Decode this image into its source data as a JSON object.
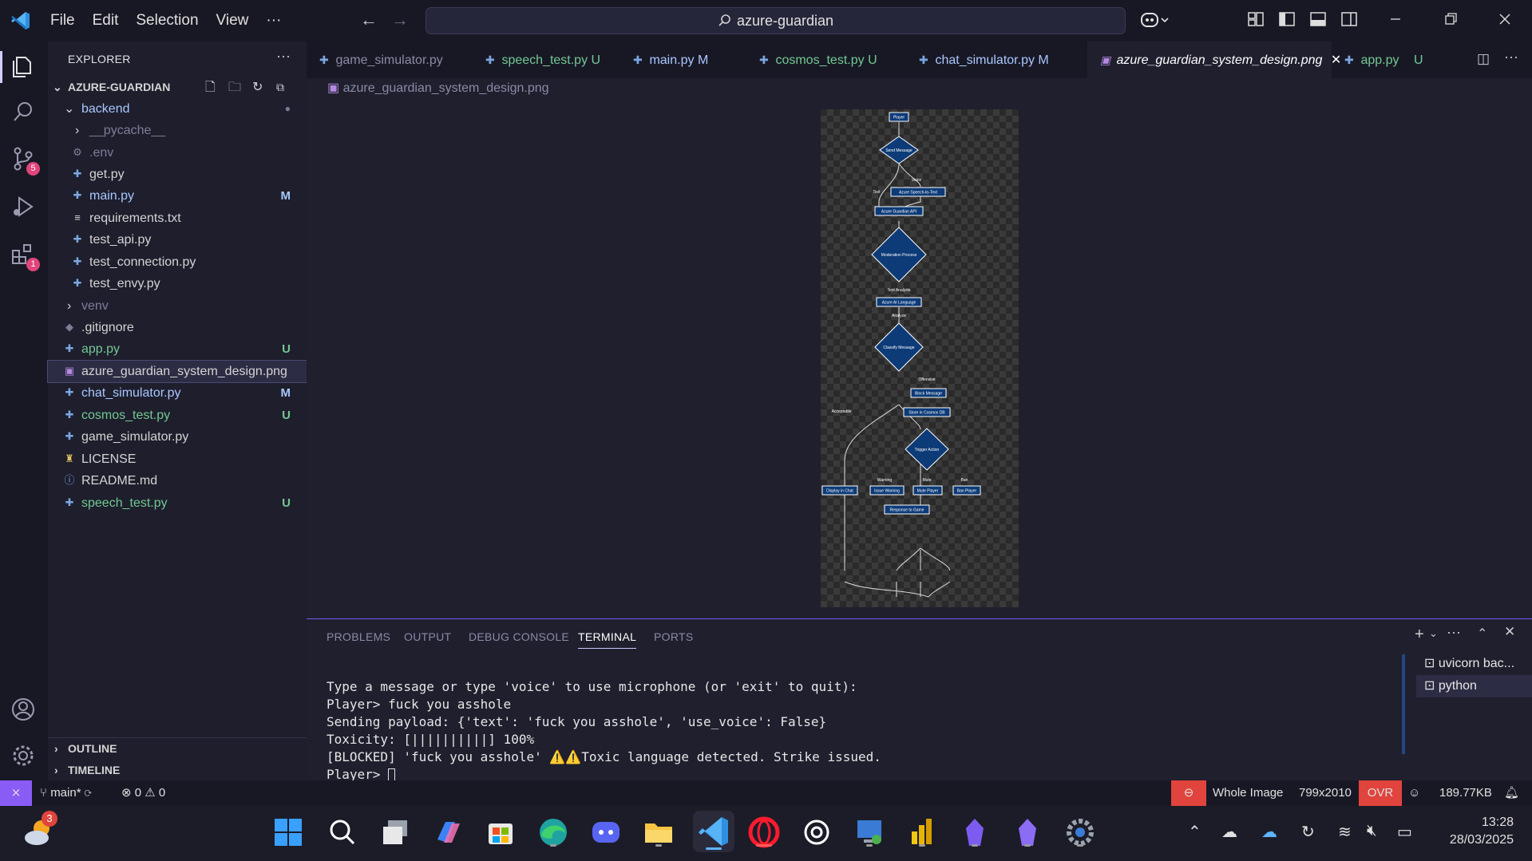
{
  "titlebar": {
    "menus": [
      "File",
      "Edit",
      "Selection",
      "View",
      "···"
    ],
    "search_text": "azure-guardian"
  },
  "activitybar": {
    "scm_badge": "5",
    "extensions_badge": "1"
  },
  "sidebar": {
    "title": "EXPLORER",
    "more": "···",
    "folder_title": "AZURE-GUARDIAN",
    "items": [
      {
        "label": "backend",
        "status": "●"
      },
      {
        "label": "__pycache__",
        "status": ""
      },
      {
        "label": ".env",
        "status": ""
      },
      {
        "label": "get.py",
        "status": ""
      },
      {
        "label": "main.py",
        "status": "M"
      },
      {
        "label": "requirements.txt",
        "status": ""
      },
      {
        "label": "test_api.py",
        "status": ""
      },
      {
        "label": "test_connection.py",
        "status": ""
      },
      {
        "label": "test_envy.py",
        "status": ""
      },
      {
        "label": "venv",
        "status": ""
      },
      {
        "label": ".gitignore",
        "status": ""
      },
      {
        "label": "app.py",
        "status": "U"
      },
      {
        "label": "azure_guardian_system_design.png",
        "status": ""
      },
      {
        "label": "chat_simulator.py",
        "status": "M"
      },
      {
        "label": "cosmos_test.py",
        "status": "U"
      },
      {
        "label": "game_simulator.py",
        "status": ""
      },
      {
        "label": "LICENSE",
        "status": ""
      },
      {
        "label": "README.md",
        "status": ""
      },
      {
        "label": "speech_test.py",
        "status": "U"
      }
    ],
    "outline": "OUTLINE",
    "timeline": "TIMELINE"
  },
  "tabs": [
    {
      "label": "game_simulator.py",
      "status": ""
    },
    {
      "label": "speech_test.py",
      "status": "U"
    },
    {
      "label": "main.py",
      "status": "M"
    },
    {
      "label": "cosmos_test.py",
      "status": "U"
    },
    {
      "label": "chat_simulator.py",
      "status": "M"
    },
    {
      "label": "azure_guardian_system_design.png",
      "status": "✕"
    },
    {
      "label": "app.py",
      "status": "U"
    }
  ],
  "breadcrumb": "azure_guardian_system_design.png",
  "diagram": {
    "player": "Player",
    "send_message": "Send Message",
    "voice": "Voice",
    "text": "Text",
    "speech_to_text": "Azure Speech-to-Text",
    "guardian_api": "Azure Guardian API",
    "moderation": "Moderation Process",
    "text_analysis": "Text Analysis",
    "ai_language": "Azure AI Language",
    "analyze": "Analyze",
    "classify": "Classify Message",
    "offensive": "Offensive",
    "acceptable": "Acceptable",
    "block": "Block Message",
    "store": "Store in Cosmos DB",
    "trigger": "Trigger Action",
    "warning": "Warning",
    "mute": "Mute",
    "ban": "Ban",
    "display": "Display in Chat",
    "issue_warning": "Issue Warning",
    "mute_player": "Mute Player",
    "ban_player": "Ban Player",
    "response": "Response to Game"
  },
  "panel": {
    "tabs": [
      "PROBLEMS",
      "OUTPUT",
      "DEBUG CONSOLE",
      "TERMINAL",
      "PORTS"
    ],
    "terminal_lines": [
      "Type a message or type 'voice' to use microphone (or 'exit' to quit):",
      "Player> fuck you asshole",
      "Sending payload: {'text': 'fuck you asshole', 'use_voice': False}",
      "Toxicity: [||||||||||] 100%",
      "[BLOCKED] 'fuck you asshole' ⚠️⚠️Toxic language detected. Strike issued.",
      "Player> "
    ],
    "terminals": [
      "uvicorn bac...",
      "python"
    ]
  },
  "statusbar": {
    "branch": "main*",
    "errors": "0",
    "warnings": "0",
    "view": "Whole Image",
    "dimensions": "799x2010",
    "ovr": "OVR",
    "filesize": "189.77KB"
  },
  "taskbar": {
    "weather_badge": "3",
    "time": "13:28",
    "date": "28/03/2025"
  }
}
